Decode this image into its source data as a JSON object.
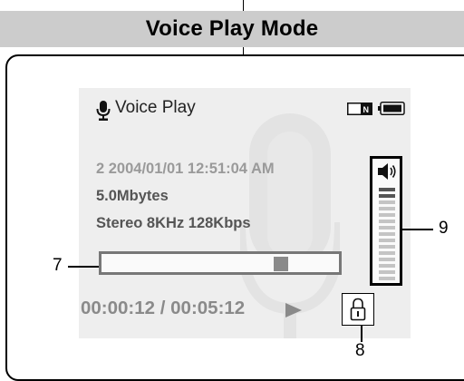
{
  "header": {
    "title": "Voice Play Mode"
  },
  "screen": {
    "mode_label": "Voice Play",
    "mode_icon": "microphone-icon",
    "status_icons": [
      "n-icon",
      "battery-icon"
    ],
    "file_info": "2  2004/01/01  12:51:04 AM",
    "file_size": "5.0Mbytes",
    "audio_format": "Stereo  8KHz  128Kbps",
    "progress_fraction": 0.8,
    "time_display": "00:00:12 / 00:05:12",
    "play_icon": "play-icon",
    "lock_icon": "lock-icon",
    "volume_levels": 15,
    "volume_dark_bars": 2
  },
  "callouts": {
    "progress": "7",
    "lock": "8",
    "volume": "9"
  },
  "colors": {
    "header_bg": "#cccccc",
    "lcd_bg": "#eeeeee",
    "dim_text": "#8a8a8a"
  }
}
